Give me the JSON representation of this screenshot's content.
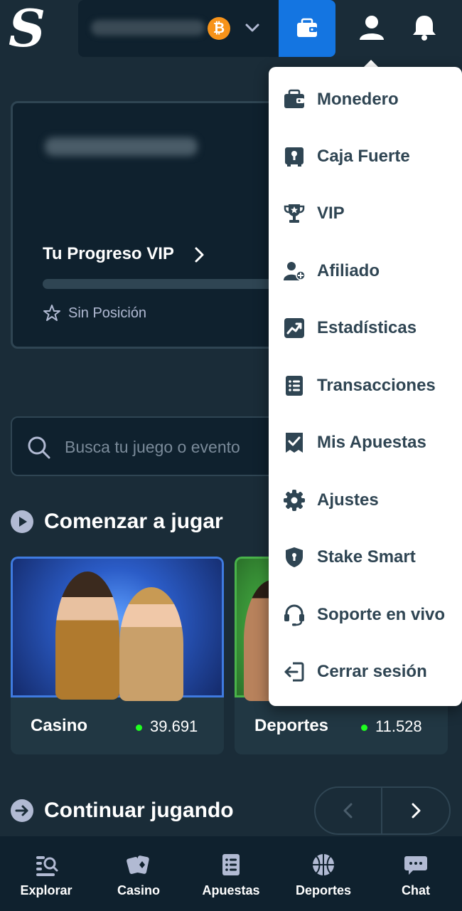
{
  "header": {
    "logo_letter": "S",
    "currency_symbol": "₿"
  },
  "vip_card": {
    "title": "Tu Progreso VIP",
    "rank": "Sin Posición"
  },
  "search": {
    "placeholder": "Busca tu juego o evento"
  },
  "sections": {
    "start_playing": "Comenzar a jugar",
    "continue_playing": "Continuar jugando"
  },
  "cards": [
    {
      "label": "Casino",
      "count": "39.691"
    },
    {
      "label": "Deportes",
      "count": "11.528"
    }
  ],
  "bottom_nav": [
    {
      "label": "Explorar",
      "icon": "explore-icon"
    },
    {
      "label": "Casino",
      "icon": "casino-cards-icon"
    },
    {
      "label": "Apuestas",
      "icon": "bets-list-icon"
    },
    {
      "label": "Deportes",
      "icon": "basketball-icon"
    },
    {
      "label": "Chat",
      "icon": "chat-icon"
    }
  ],
  "menu": [
    {
      "label": "Monedero",
      "icon": "wallet-icon"
    },
    {
      "label": "Caja Fuerte",
      "icon": "vault-icon"
    },
    {
      "label": "VIP",
      "icon": "trophy-icon"
    },
    {
      "label": "Afiliado",
      "icon": "affiliate-icon"
    },
    {
      "label": "Estadísticas",
      "icon": "stats-chart-icon"
    },
    {
      "label": "Transacciones",
      "icon": "transactions-icon"
    },
    {
      "label": "Mis Apuestas",
      "icon": "my-bets-icon"
    },
    {
      "label": "Ajustes",
      "icon": "settings-gear-icon"
    },
    {
      "label": "Stake Smart",
      "icon": "shield-icon"
    },
    {
      "label": "Soporte en vivo",
      "icon": "headset-icon"
    },
    {
      "label": "Cerrar sesión",
      "icon": "logout-icon"
    }
  ],
  "colors": {
    "background": "#1a2c38",
    "panel": "#0f212e",
    "accent_blue": "#1475e1",
    "online_green": "#1fff20",
    "menu_text": "#2f4553",
    "bitcoin": "#f7931a"
  }
}
